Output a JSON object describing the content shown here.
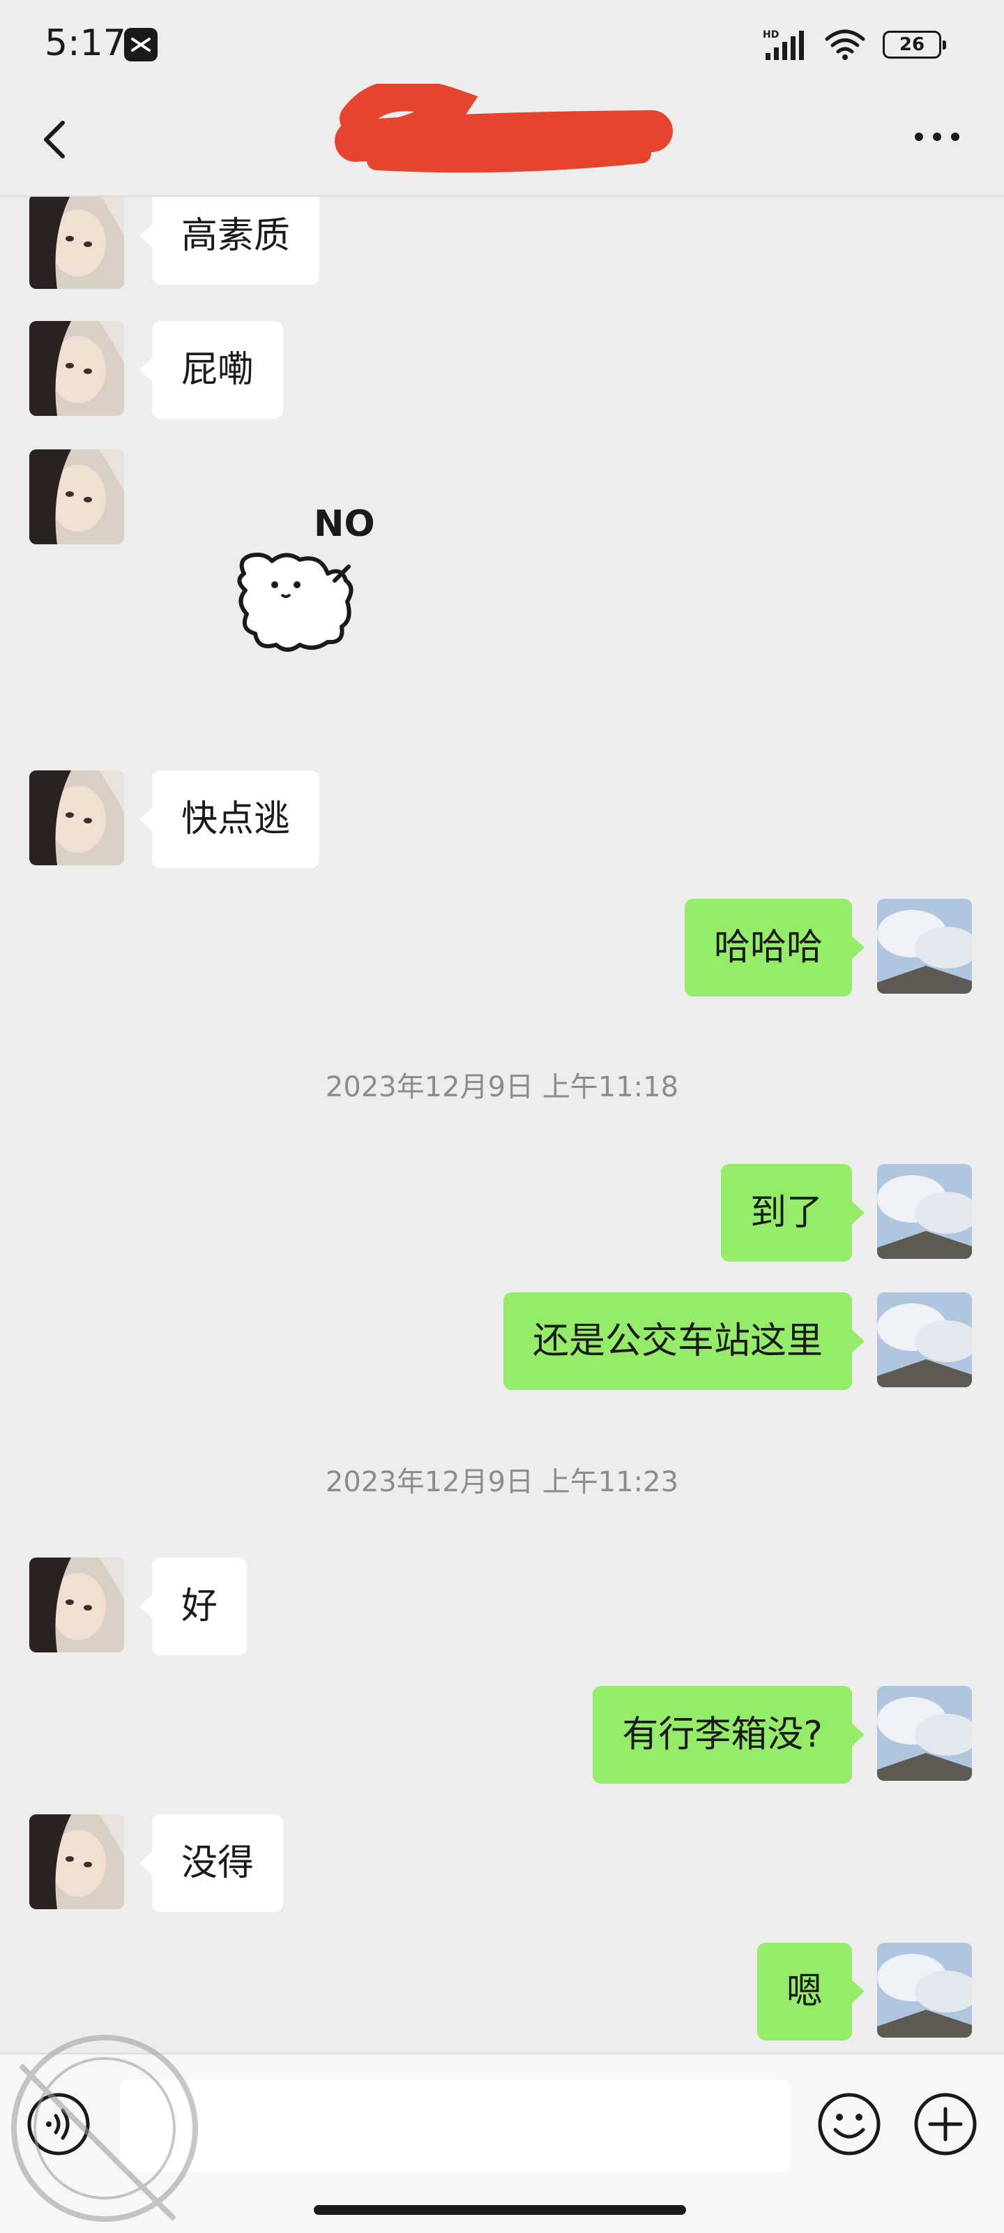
{
  "status_bar": {
    "time": "5:17",
    "network_badge": "HD",
    "battery": "26",
    "icons": [
      "capcut-icon",
      "signal-icon",
      "wifi-icon",
      "battery-icon"
    ]
  },
  "nav": {
    "back_icon": "chevron-left-icon",
    "title_redacted": true,
    "more_icon": "more-icon"
  },
  "colors": {
    "background": "#EDEDED",
    "incoming_bubble": "#FFFFFF",
    "outgoing_bubble": "#95EC69",
    "redaction": "#E5452F",
    "timestamp_text": "#8C8C8C"
  },
  "messages": [
    {
      "type": "in",
      "text": "高素质"
    },
    {
      "type": "in",
      "text": "屁嘞"
    },
    {
      "type": "in",
      "sticker": "dog-no-sticker",
      "sticker_text": "NO"
    },
    {
      "type": "in",
      "text": "快点逃"
    },
    {
      "type": "out",
      "text": "哈哈哈"
    },
    {
      "type": "time",
      "text": "2023年12月9日 上午11:18"
    },
    {
      "type": "out",
      "text": "到了"
    },
    {
      "type": "out",
      "text": "还是公交车站这里"
    },
    {
      "type": "time",
      "text": "2023年12月9日 上午11:23"
    },
    {
      "type": "in",
      "text": "好"
    },
    {
      "type": "out",
      "text": "有行李箱没?"
    },
    {
      "type": "in",
      "text": "没得"
    },
    {
      "type": "out",
      "text": "嗯"
    }
  ],
  "input_bar": {
    "value": "",
    "icons": [
      "voice-icon",
      "emoji-icon",
      "plus-icon"
    ]
  }
}
